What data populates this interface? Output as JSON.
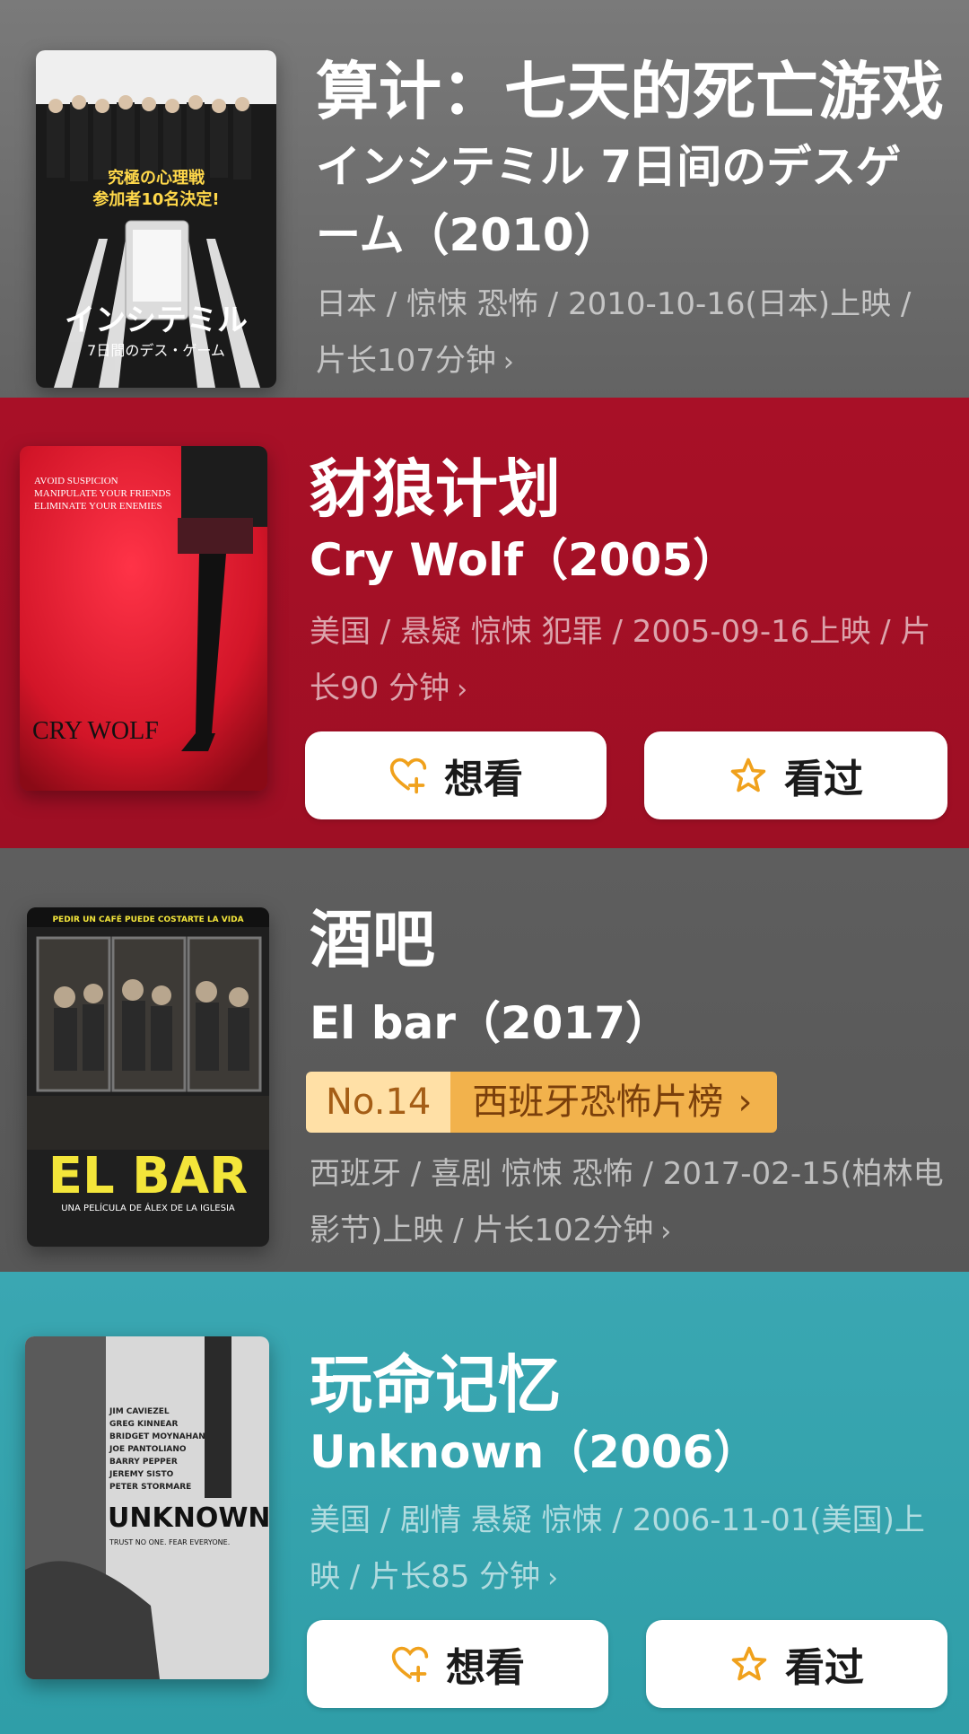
{
  "movies": [
    {
      "title": "算计：七天的死亡游戏",
      "subtitle": "インシテミル 7日间のデスゲーム（2010）",
      "meta": "日本 / 惊悚 恐怖 / 2010-10-16(日本)上映 / 片长107分钟",
      "poster_text": {
        "line1": "究極の心理戦",
        "line2": "参加者10名決定!",
        "main": "インシテミル",
        "sub": "7日間のデス・ゲーム"
      }
    },
    {
      "title": "豺狼计划",
      "subtitle": "Cry Wolf（2005）",
      "meta": "美国 / 悬疑 惊悚 犯罪 / 2005-09-16上映 / 片长90 分钟",
      "poster_text": {
        "tag1": "AVOID SUSPICION",
        "tag2": "MANIPULATE YOUR FRIENDS",
        "tag3": "ELIMINATE YOUR ENEMIES",
        "main": "CRY WOLF"
      },
      "buttons": {
        "want": "想看",
        "seen": "看过"
      }
    },
    {
      "title": "酒吧",
      "subtitle": "El bar（2017）",
      "rank": {
        "no": "No.14",
        "list": "西班牙恐怖片榜"
      },
      "meta": "西班牙 / 喜剧 惊悚 恐怖 / 2017-02-15(柏林电影节)上映 / 片长102分钟",
      "poster_text": {
        "top": "PEDIR UN CAFÉ PUEDE COSTARTE LA VIDA",
        "main": "EL BAR",
        "sub": "UNA PELÍCULA DE ÁLEX DE LA IGLESIA"
      }
    },
    {
      "title": "玩命记忆",
      "subtitle": "Unknown（2006）",
      "meta": "美国 / 剧情 悬疑 惊悚 / 2006-11-01(美国)上映 / 片长85 分钟",
      "poster_text": {
        "cast": [
          "JIM CAVIEZEL",
          "GREG KINNEAR",
          "BRIDGET MOYNAHAN",
          "JOE PANTOLIANO",
          "BARRY PEPPER",
          "JEREMY SISTO",
          "PETER STORMARE"
        ],
        "main": "UNKNOWN",
        "tagline": "TRUST NO ONE. FEAR EVERYONE."
      },
      "buttons": {
        "want": "想看",
        "seen": "看过"
      }
    }
  ],
  "colors": {
    "card1": "#6c6c6c",
    "card2": "#a31027",
    "card3": "#5a5a5a",
    "card4": "#34a3ad",
    "icon_accent": "#f0a11c"
  },
  "icons": {
    "want": "heart-plus-icon",
    "seen": "star-icon",
    "more": "chevron-right-icon"
  }
}
